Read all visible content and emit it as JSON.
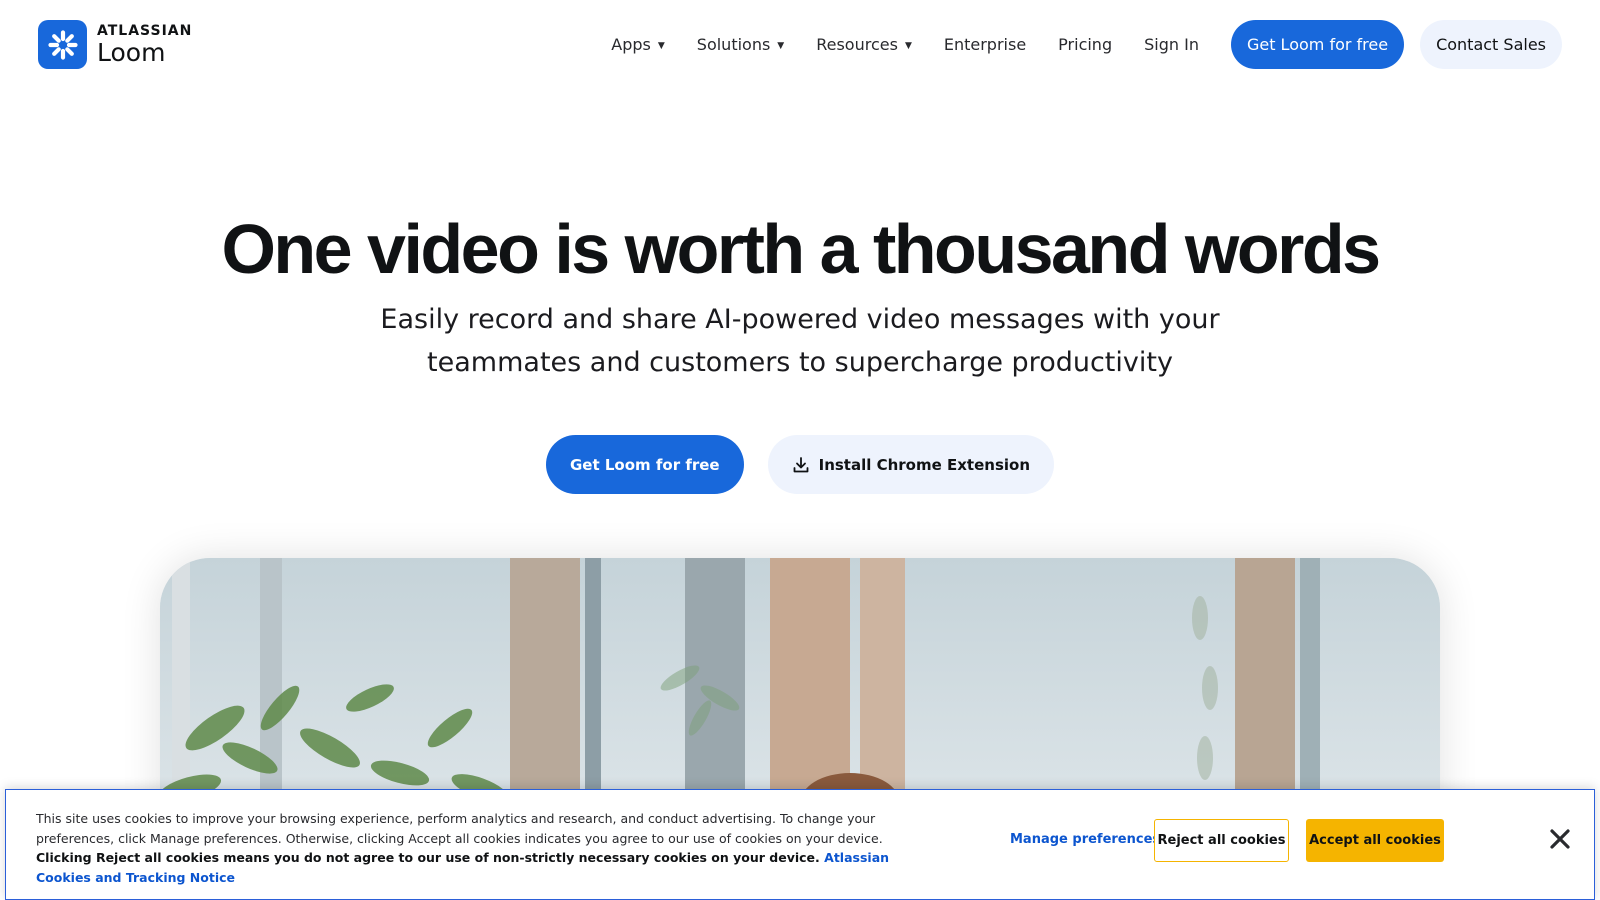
{
  "brand": {
    "company": "ATLASSIAN",
    "product": "Loom",
    "logo_icon": "loom-asterisk-icon",
    "color": "#1868db"
  },
  "nav": {
    "items": [
      {
        "label": "Apps",
        "dropdown": true
      },
      {
        "label": "Solutions",
        "dropdown": true
      },
      {
        "label": "Resources",
        "dropdown": true
      },
      {
        "label": "Enterprise",
        "dropdown": false
      },
      {
        "label": "Pricing",
        "dropdown": false
      },
      {
        "label": "Sign In",
        "dropdown": false
      }
    ],
    "caret": "▼",
    "primary_button": "Get Loom for free",
    "secondary_button": "Contact Sales"
  },
  "hero": {
    "title": "One video is worth a thousand words",
    "subtitle": "Easily record and share AI-powered video messages with your teammates and customers to supercharge productivity",
    "cta_primary": "Get Loom for free",
    "cta_secondary": "Install Chrome Extension",
    "cta_secondary_icon": "download-icon"
  },
  "video": {
    "description_icon": "hero-video-preview"
  },
  "cookie_banner": {
    "text_1": "This site uses cookies to improve your browsing experience, perform analytics and research, and conduct advertising. To change your preferences, click Manage preferences. Otherwise, clicking Accept all cookies indicates you agree to our use of cookies on your device.",
    "text_2": "Clicking Reject all cookies means you do not agree to our use of non-strictly necessary cookies on your device",
    "link": "Atlassian Cookies and Tracking Notice",
    "manage": "Manage preferences",
    "reject": "Reject all cookies",
    "accept": "Accept all cookies",
    "close_icon": "close-icon",
    "accent_color": "#f5b400",
    "link_color": "#0c55cf"
  }
}
